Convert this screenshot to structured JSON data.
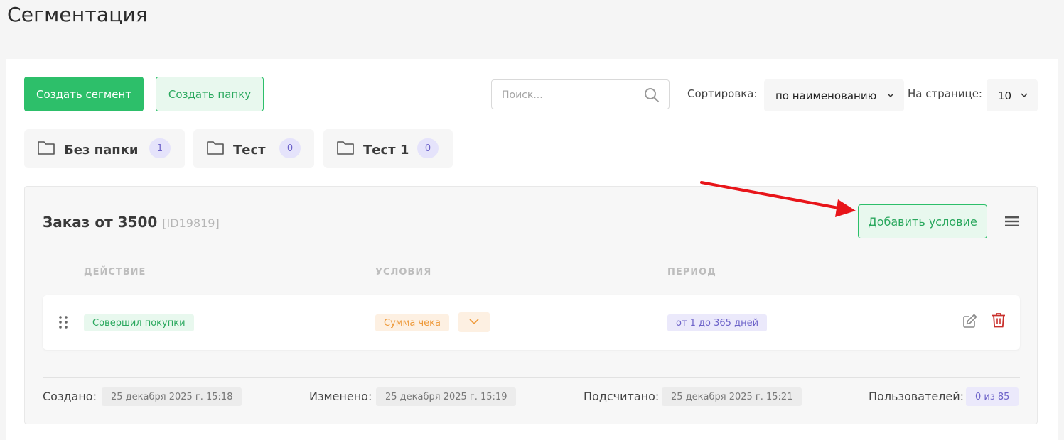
{
  "page": {
    "title": "Сегментация"
  },
  "toolbar": {
    "create_segment": "Создать сегмент",
    "create_folder": "Создать папку",
    "search_placeholder": "Поиск...",
    "sort_label": "Сортировка:",
    "sort_value": "по наименованию",
    "perpage_label": "На странице:",
    "perpage_value": "10"
  },
  "folders": [
    {
      "name": "Без папки",
      "count": "1"
    },
    {
      "name": "Тест",
      "count": "0"
    },
    {
      "name": "Тест 1",
      "count": "0"
    }
  ],
  "segment": {
    "name": "Заказ от 3500",
    "id": "[ID19819]",
    "add_condition": "Добавить условие",
    "columns": {
      "action": "ДЕЙСТВИЕ",
      "conditions": "УСЛОВИЯ",
      "period": "ПЕРИОД"
    },
    "row": {
      "action": "Совершил покупки",
      "condition": "Сумма чека",
      "period": "от 1 до 365 дней"
    },
    "footer": {
      "created_label": "Создано:",
      "created_value": "25 декабря 2025 г. 15:18",
      "modified_label": "Изменено:",
      "modified_value": "25 декабря 2025 г. 15:19",
      "counted_label": "Подсчитано:",
      "counted_value": "25 декабря 2025 г. 15:21",
      "users_label": "Пользователей:",
      "users_value": "0 из 85"
    }
  },
  "colors": {
    "accent_green": "#2dbf6a",
    "purple": "#6d63c9",
    "orange": "#ee9a3b",
    "delete_red": "#c9302c",
    "annotation_arrow": "#e8151a"
  },
  "icons": [
    "search-icon",
    "chevron-down-icon",
    "folder-icon",
    "menu-icon",
    "drag-handle-icon",
    "edit-icon",
    "trash-icon",
    "arrow-annotation"
  ]
}
